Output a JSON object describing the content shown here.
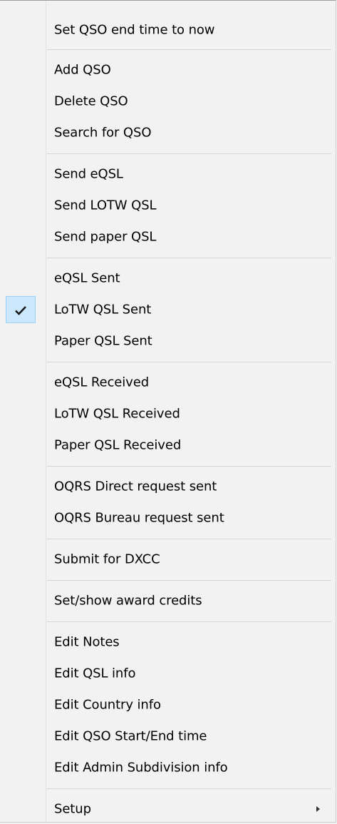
{
  "menu": {
    "items": [
      {
        "label": "Set QSO end time to now"
      },
      {
        "label": "Add QSO"
      },
      {
        "label": "Delete QSO"
      },
      {
        "label": "Search for QSO"
      },
      {
        "label": "Send eQSL"
      },
      {
        "label": "Send LOTW QSL"
      },
      {
        "label": "Send paper QSL"
      },
      {
        "label": "eQSL Sent"
      },
      {
        "label": "LoTW QSL Sent",
        "checked": true
      },
      {
        "label": "Paper QSL Sent"
      },
      {
        "label": "eQSL Received"
      },
      {
        "label": "LoTW QSL Received"
      },
      {
        "label": "Paper QSL Received"
      },
      {
        "label": "OQRS Direct request sent"
      },
      {
        "label": "OQRS Bureau request sent"
      },
      {
        "label": "Submit for DXCC"
      },
      {
        "label": "Set/show award credits"
      },
      {
        "label": "Edit Notes"
      },
      {
        "label": "Edit QSL info"
      },
      {
        "label": "Edit Country info"
      },
      {
        "label": "Edit QSO Start/End time"
      },
      {
        "label": "Edit Admin Subdivision info"
      },
      {
        "label": "Setup",
        "has_submenu": true
      }
    ]
  },
  "colors": {
    "check_highlight": "#cce8ff",
    "check_border": "#99d1ff"
  }
}
